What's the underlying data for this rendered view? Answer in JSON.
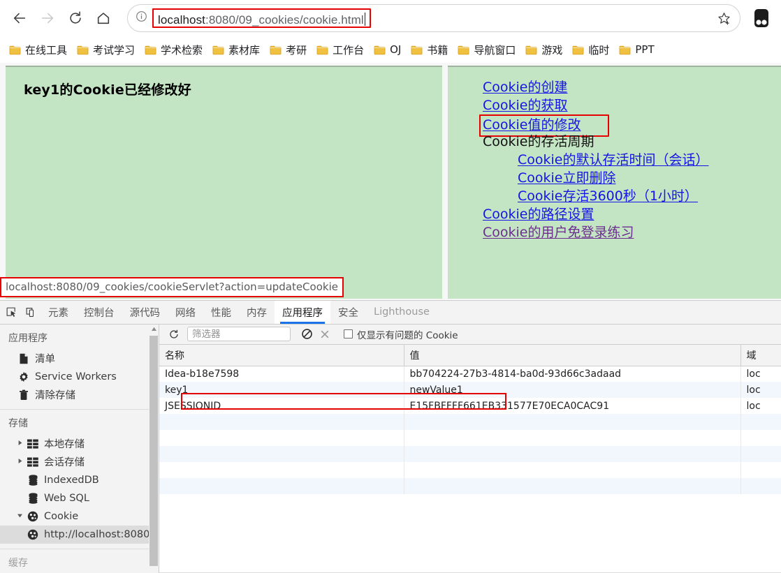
{
  "browser": {
    "nav": {
      "back_title": "后退",
      "forward_title": "前进",
      "reload_title": "重新加载",
      "home_title": "主页"
    },
    "omnibox": {
      "host": "localhost",
      "path": ":8080/09_cookies/cookie.html",
      "full_url": "localhost:8080/09_cookies/cookie.html",
      "info_icon": "info-circle-icon",
      "star_icon": "star-add-bookmark-icon",
      "profile_icon": "extension-icon"
    },
    "bookmarks": [
      {
        "label": "在线工具"
      },
      {
        "label": "考试学习"
      },
      {
        "label": "学术检索"
      },
      {
        "label": "素材库"
      },
      {
        "label": "考研"
      },
      {
        "label": "工作台"
      },
      {
        "label": "OJ"
      },
      {
        "label": "书籍"
      },
      {
        "label": "导航窗口"
      },
      {
        "label": "游戏"
      },
      {
        "label": "临时"
      },
      {
        "label": "PPT"
      }
    ]
  },
  "page": {
    "message": "key1的Cookie已经修改好",
    "status_bubble": "localhost:8080/09_cookies/cookieServlet?action=updateCookie",
    "background_color": "#c4e5c4",
    "links": [
      {
        "label": "Cookie的创建",
        "type": "link",
        "indent": false,
        "highlighted": false,
        "visited": false
      },
      {
        "label": "Cookie的获取",
        "type": "link",
        "indent": false,
        "highlighted": false,
        "visited": false
      },
      {
        "label": "Cookie值的修改",
        "type": "link",
        "indent": false,
        "highlighted": true,
        "visited": false
      },
      {
        "label": "Cookie的存活周期",
        "type": "text",
        "indent": false,
        "highlighted": false,
        "visited": false
      },
      {
        "label": "Cookie的默认存活时间（会话）",
        "type": "link",
        "indent": true,
        "highlighted": false,
        "visited": false
      },
      {
        "label": "Cookie立即删除",
        "type": "link",
        "indent": true,
        "highlighted": false,
        "visited": false
      },
      {
        "label": "Cookie存活3600秒（1小时）",
        "type": "link",
        "indent": true,
        "highlighted": false,
        "visited": false
      },
      {
        "label": "Cookie的路径设置",
        "type": "link",
        "indent": false,
        "highlighted": false,
        "visited": false
      },
      {
        "label": "Cookie的用户免登录练习",
        "type": "link",
        "indent": false,
        "highlighted": false,
        "visited": true
      }
    ]
  },
  "devtools": {
    "inspect_icon": "inspect-element-icon",
    "device_icon": "device-toolbar-icon",
    "tabs": [
      {
        "label": "元素",
        "active": false,
        "dim": false
      },
      {
        "label": "控制台",
        "active": false,
        "dim": false
      },
      {
        "label": "源代码",
        "active": false,
        "dim": false
      },
      {
        "label": "网络",
        "active": false,
        "dim": false
      },
      {
        "label": "性能",
        "active": false,
        "dim": false
      },
      {
        "label": "内存",
        "active": false,
        "dim": false
      },
      {
        "label": "应用程序",
        "active": true,
        "dim": false
      },
      {
        "label": "安全",
        "active": false,
        "dim": false
      },
      {
        "label": "Lighthouse",
        "active": false,
        "dim": true
      }
    ],
    "sidebar": {
      "section_application": "应用程序",
      "application_items": [
        {
          "label": "清单",
          "icon": "document-icon"
        },
        {
          "label": "Service Workers",
          "icon": "gear-icon"
        },
        {
          "label": "清除存储",
          "icon": "trash-icon"
        }
      ],
      "section_storage": "存储",
      "storage_items": [
        {
          "label": "本地存储",
          "icon": "grid-icon",
          "expandable": true,
          "expanded": false
        },
        {
          "label": "会话存储",
          "icon": "grid-icon",
          "expandable": true,
          "expanded": false
        },
        {
          "label": "IndexedDB",
          "icon": "database-icon",
          "expandable": false,
          "expanded": false
        },
        {
          "label": "Web SQL",
          "icon": "database-icon",
          "expandable": false,
          "expanded": false
        },
        {
          "label": "Cookie",
          "icon": "cookie-icon",
          "expandable": true,
          "expanded": true
        }
      ],
      "cookie_child": {
        "label": "http://localhost:8080",
        "icon": "cookie-icon",
        "selected": true
      },
      "section_cache_partial": "缓存"
    },
    "toolbar": {
      "refresh_icon": "refresh-icon",
      "filter_placeholder": "筛选器",
      "filter_value": "",
      "clear_all_icon": "clear-all-cookies-icon",
      "delete_icon": "delete-selected-icon",
      "only_problem_label": "仅显示有问题的 Cookie",
      "only_problem_checked": false
    },
    "table": {
      "columns": [
        "名称",
        "值",
        "域"
      ],
      "rows": [
        {
          "name": "Idea-b18e7598",
          "value": "bb704224-27b3-4814-ba0d-93d66c3adaad",
          "domain": "loc",
          "highlighted": false
        },
        {
          "name": "key1",
          "value": "newValue1",
          "domain": "loc",
          "highlighted": true
        },
        {
          "name": "JSESSIONID",
          "value": "E15FBFFFF661EB331577E70ECA0CAC91",
          "domain": "loc",
          "highlighted": false
        }
      ]
    }
  },
  "annotations": {
    "highlight_color": "#e60000"
  }
}
